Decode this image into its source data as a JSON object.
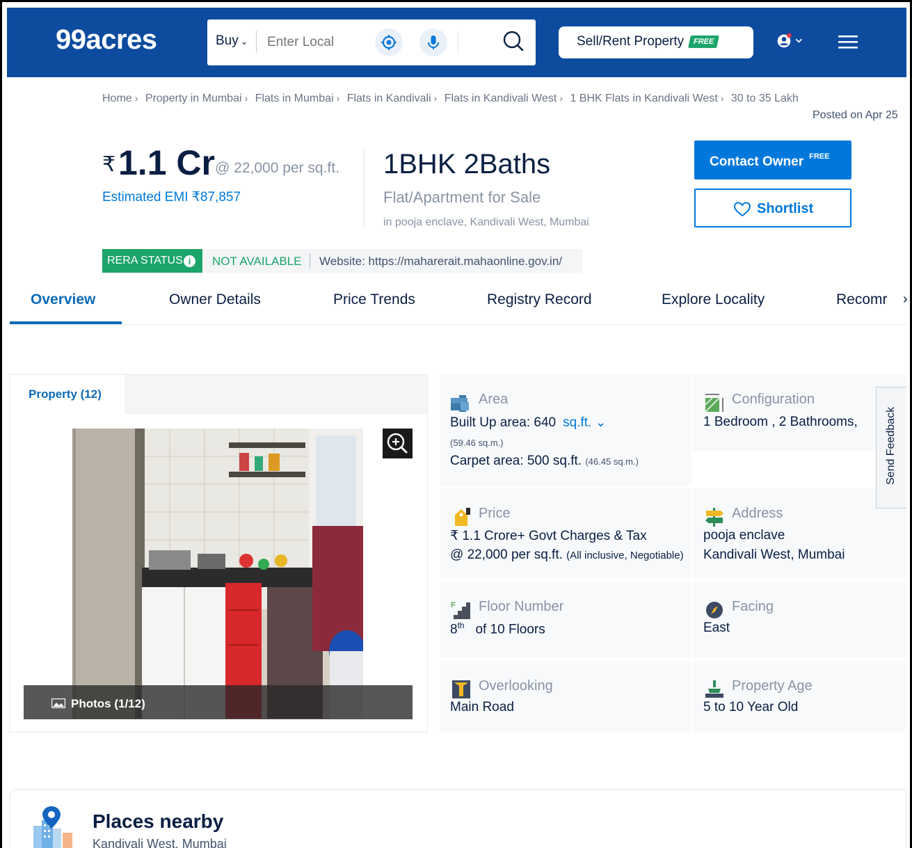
{
  "header": {
    "logo": "99acres",
    "buy_label": "Buy",
    "search_placeholder": "Enter Local",
    "sell_label": "Sell/Rent Property",
    "free_tag": "FREE"
  },
  "breadcrumb": [
    "Home",
    "Property in Mumbai",
    "Flats in Mumbai",
    "Flats in Kandivali",
    "Flats in Kandivali West",
    "1 BHK Flats in Kandivali West",
    "30 to 35 Lakh"
  ],
  "posted": "Posted on Apr 25",
  "listing": {
    "rupee": "₹",
    "price": "1.1 Cr",
    "price_per_sqft": "@ 22,000 per sq.ft.",
    "emi": "Estimated EMI ₹87,857",
    "title": "1BHK 2Baths",
    "type": "Flat/Apartment for Sale",
    "locality": "in pooja enclave, Kandivali West, Mumbai"
  },
  "actions": {
    "contact_label": "Contact Owner",
    "contact_tag": "FREE",
    "shortlist_label": "Shortlist"
  },
  "rera": {
    "badge": "RERA STATUS",
    "info": "i",
    "status": "NOT AVAILABLE",
    "website": "Website: https://maharerait.mahaonline.gov.in/"
  },
  "tabs": [
    {
      "label": "Overview"
    },
    {
      "label": "Owner Details"
    },
    {
      "label": "Price Trends"
    },
    {
      "label": "Registry Record"
    },
    {
      "label": "Explore Locality"
    },
    {
      "label": "Recomr"
    }
  ],
  "tab_next": "›",
  "gallery": {
    "tab_label": "Property (12)",
    "photos_label": "Photos (1/12)"
  },
  "details": {
    "area": {
      "title": "Area",
      "built_up": "Built Up area: 640",
      "unit": "sq.ft.",
      "built_up_sqm": "(59.46 sq.m.)",
      "carpet": "Carpet area: 500 sq.ft.",
      "carpet_sqm": "(46.45 sq.m.)"
    },
    "configuration": {
      "title": "Configuration",
      "value": "1 Bedroom , 2 Bathrooms,"
    },
    "price": {
      "title": "Price",
      "line1": "₹ 1.1 Crore+ Govt Charges & Tax",
      "line2": "@ 22,000 per sq.ft.",
      "line2_note": "(All inclusive, Negotiable)"
    },
    "address": {
      "title": "Address",
      "line1": "pooja enclave",
      "line2": "Kandivali West, Mumbai"
    },
    "floor": {
      "title": "Floor Number",
      "floor": "8",
      "suffix": "th",
      "of": "of 10 Floors"
    },
    "facing": {
      "title": "Facing",
      "value": "East"
    },
    "overlooking": {
      "title": "Overlooking",
      "value": "Main Road"
    },
    "age": {
      "title": "Property Age",
      "value": "5 to 10 Year Old"
    }
  },
  "feedback": "Send Feedback",
  "places": {
    "title": "Places nearby",
    "subtitle": "Kandivali West, Mumbai"
  },
  "colors": {
    "header_bg": "#0D4B9F",
    "accent_blue": "#0078DB",
    "rera_green": "#1BA56A",
    "tab_active": "#0D6AB8"
  }
}
